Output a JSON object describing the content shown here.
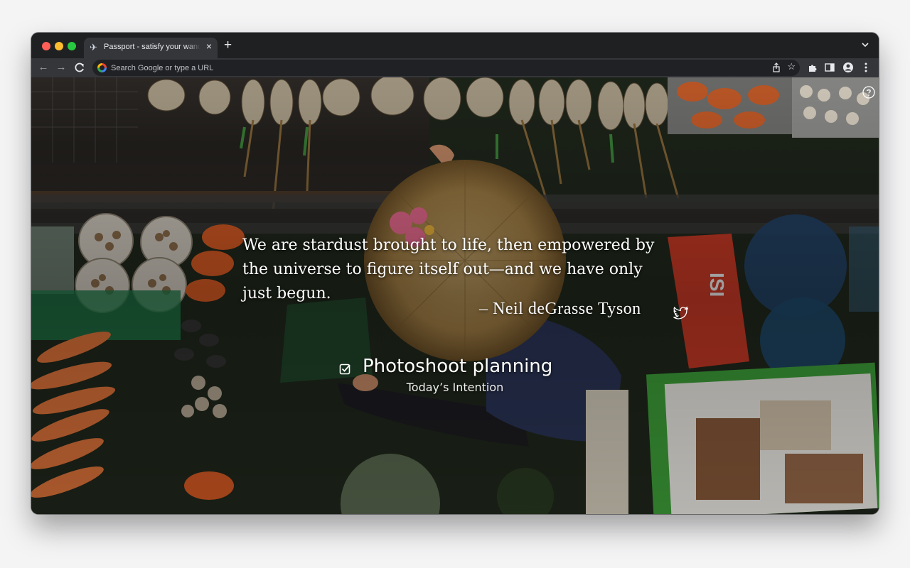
{
  "browser": {
    "tab": {
      "favicon": "airplane-icon",
      "title": "Passport - satisfy your wanderlust"
    },
    "omnibox": {
      "placeholder": "Search Google or type a URL"
    }
  },
  "page": {
    "quote": {
      "text": "We are stardust brought to life, then empowered by the universe to figure itself out—and we have only just begun.",
      "author": "– Neil deGrasse Tyson"
    },
    "intention": {
      "title": "Photoshoot planning",
      "label": "Today’s Intention"
    }
  }
}
